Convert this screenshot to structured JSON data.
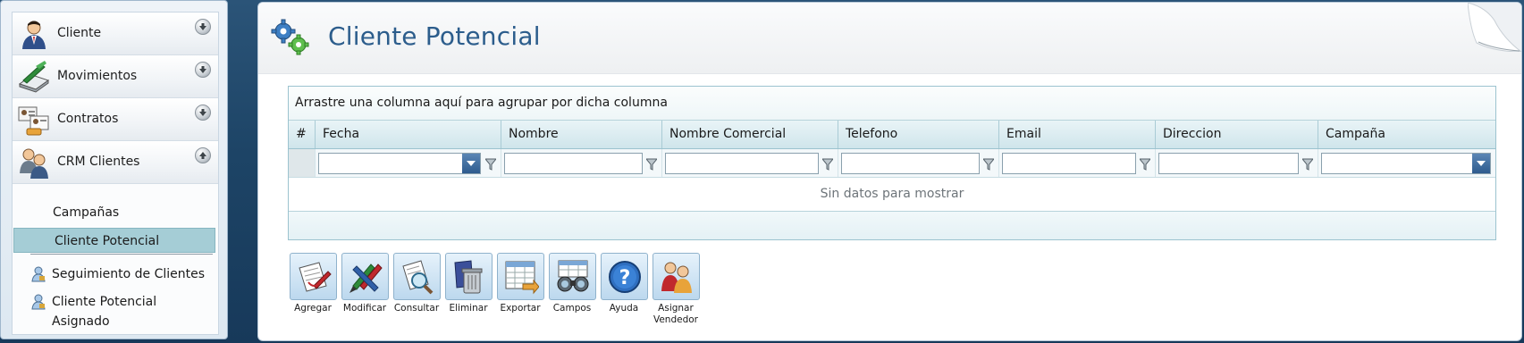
{
  "sidebar": {
    "groups": [
      {
        "label": "Cliente",
        "icon": "person-icon",
        "expanded": false
      },
      {
        "label": "Movimientos",
        "icon": "scanner-icon",
        "expanded": false
      },
      {
        "label": "Contratos",
        "icon": "id-cards-icon",
        "expanded": false
      },
      {
        "label": "CRM Clientes",
        "icon": "users-icon",
        "expanded": true
      }
    ],
    "sub_items": [
      {
        "label": "Campañas",
        "active": false
      },
      {
        "label": "Cliente Potencial",
        "active": true
      }
    ],
    "links": [
      {
        "label": "Seguimiento de Clientes",
        "icon": "user-lock-icon"
      },
      {
        "label": "Cliente Potencial Asignado",
        "icon": "user-lock-icon"
      }
    ]
  },
  "main": {
    "title": "Cliente Potencial",
    "title_icon": "gears-icon"
  },
  "grid": {
    "group_panel_text": "Arrastre una columna aquí para agrupar por dicha columna",
    "columns": [
      {
        "label": "#"
      },
      {
        "label": "Fecha"
      },
      {
        "label": "Nombre"
      },
      {
        "label": "Nombre Comercial"
      },
      {
        "label": "Telefono"
      },
      {
        "label": "Email"
      },
      {
        "label": "Direccion"
      },
      {
        "label": "Campaña"
      }
    ],
    "empty_text": "Sin datos para mostrar"
  },
  "toolbar": {
    "buttons": [
      {
        "label": "Agregar",
        "icon": "add-document-icon"
      },
      {
        "label": "Modificar",
        "icon": "pencils-icon"
      },
      {
        "label": "Consultar",
        "icon": "magnifier-icon"
      },
      {
        "label": "Eliminar",
        "icon": "trash-icon"
      },
      {
        "label": "Exportar",
        "icon": "export-spreadsheet-icon"
      },
      {
        "label": "Campos",
        "icon": "binoculars-icon"
      },
      {
        "label": "Ayuda",
        "icon": "help-icon"
      },
      {
        "label": "Asignar Vendedor",
        "icon": "assign-users-icon"
      }
    ]
  },
  "colors": {
    "title": "#2c5d8c",
    "active_item_bg": "#a5cdd6",
    "grid_border": "#9cc3cf"
  }
}
